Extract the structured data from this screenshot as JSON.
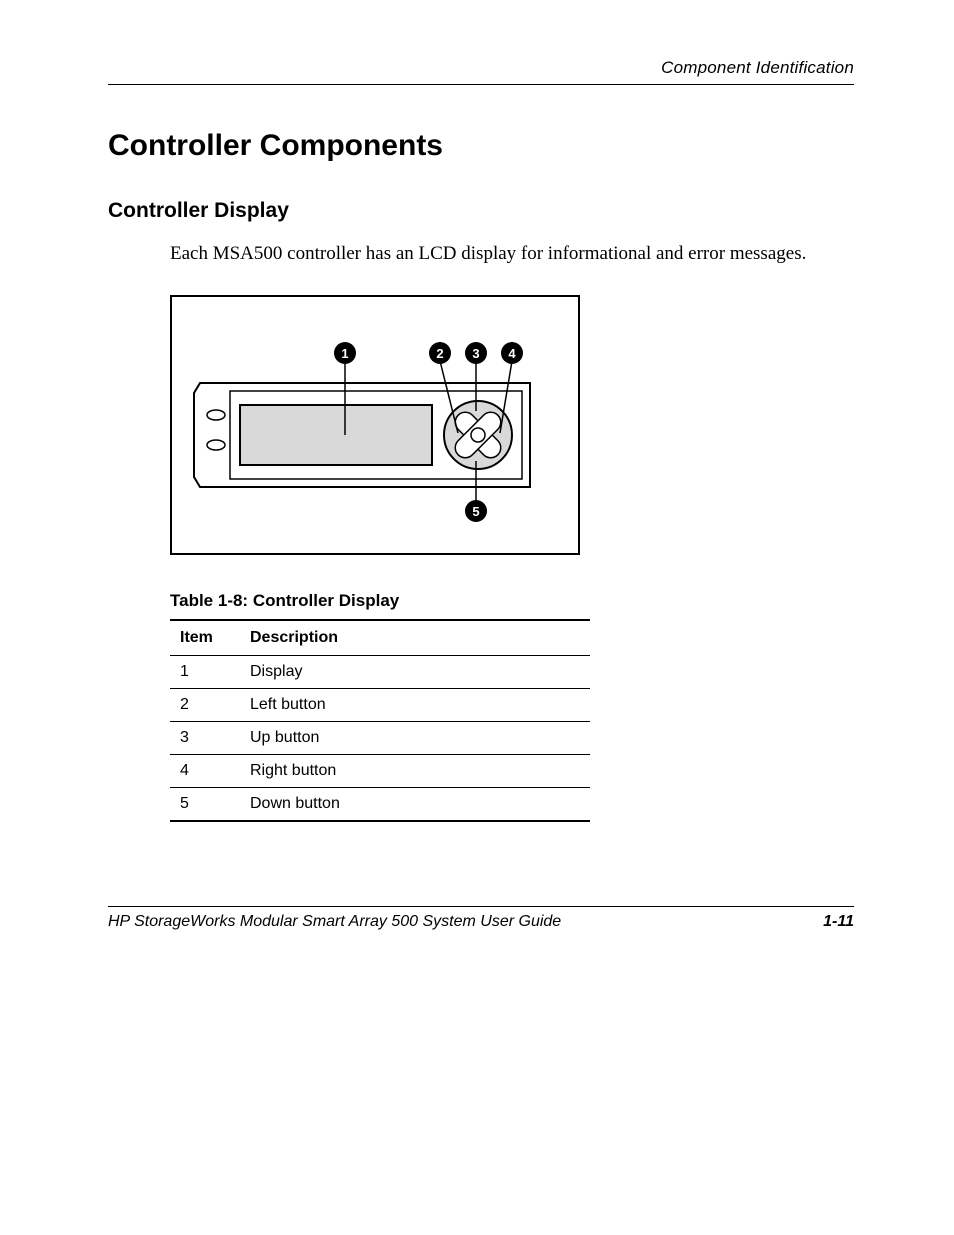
{
  "header": {
    "running_head": "Component Identification"
  },
  "titles": {
    "h1": "Controller Components",
    "h2": "Controller Display"
  },
  "paragraph": "Each MSA500 controller has an LCD display for informational and error messages.",
  "callouts": {
    "c1": "1",
    "c2": "2",
    "c3": "3",
    "c4": "4",
    "c5": "5"
  },
  "table": {
    "caption": "Table 1-8:  Controller Display",
    "headers": {
      "item": "Item",
      "desc": "Description"
    },
    "rows": [
      {
        "item": "1",
        "desc": "Display"
      },
      {
        "item": "2",
        "desc": "Left button"
      },
      {
        "item": "3",
        "desc": "Up button"
      },
      {
        "item": "4",
        "desc": "Right button"
      },
      {
        "item": "5",
        "desc": "Down button"
      }
    ]
  },
  "footer": {
    "doc_title": "HP StorageWorks Modular Smart Array 500 System User Guide",
    "page_number": "1-11"
  }
}
